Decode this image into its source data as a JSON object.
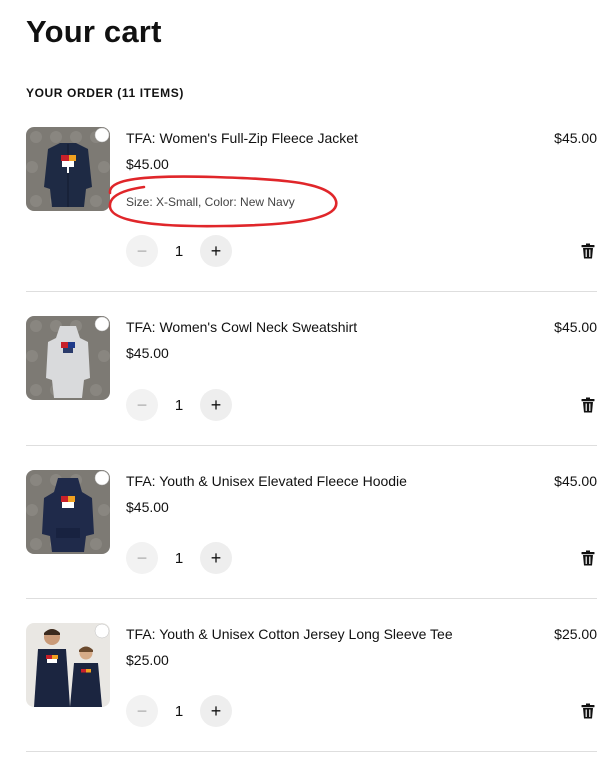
{
  "page": {
    "title": "Your cart"
  },
  "order": {
    "heading": "YOUR ORDER (11 ITEMS)"
  },
  "items": [
    {
      "name": "TFA: Women's Full-Zip Fleece Jacket",
      "price": "$45.00",
      "unit_price": "$45.00",
      "variant": "Size: X-Small, Color: New Navy",
      "quantity": "1",
      "garment_color": "#1e2a44"
    },
    {
      "name": "TFA: Women's Cowl Neck Sweatshirt",
      "price": "$45.00",
      "unit_price": "$45.00",
      "quantity": "1",
      "garment_color": "#d9dadc"
    },
    {
      "name": "TFA: Youth & Unisex Elevated Fleece Hoodie",
      "price": "$45.00",
      "unit_price": "$45.00",
      "quantity": "1",
      "garment_color": "#1f2a4a"
    },
    {
      "name": "TFA: Youth & Unisex Cotton Jersey Long Sleeve Tee",
      "price": "$25.00",
      "unit_price": "$25.00",
      "quantity": "1",
      "garment_color": "#1b2540"
    }
  ],
  "controls": {
    "minus_symbol": "−",
    "plus_symbol": "+"
  },
  "colors": {
    "annotation": "#e0262a",
    "divider": "#dedede",
    "button_bg": "#f2f2f2"
  }
}
